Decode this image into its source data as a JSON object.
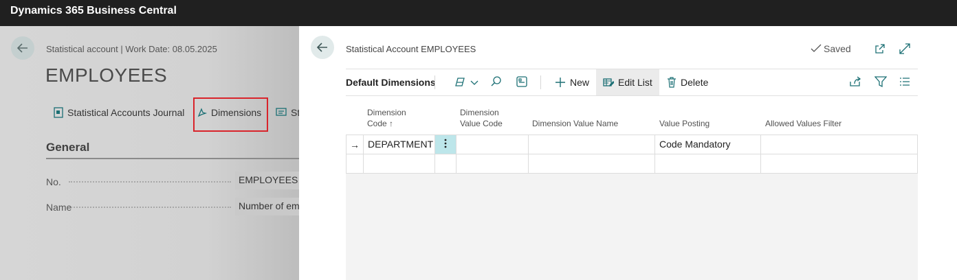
{
  "app": {
    "title": "Dynamics 365 Business Central"
  },
  "background_page": {
    "caption": "Statistical account | Work Date: 08.05.2025",
    "title": "EMPLOYEES",
    "actions": [
      {
        "label": "Statistical Accounts Journal",
        "icon": "journal-icon"
      },
      {
        "label": "Dimensions",
        "icon": "dimensions-icon"
      },
      {
        "label": "St",
        "icon": "statistics-icon"
      }
    ],
    "section_title": "General",
    "fields": [
      {
        "label": "No.",
        "value": "EMPLOYEES"
      },
      {
        "label": "Name",
        "value": "Number of em"
      }
    ]
  },
  "panel": {
    "caption": "Statistical Account EMPLOYEES",
    "saved_label": "Saved",
    "toolbar": {
      "title": "Default Dimensions",
      "new_label": "New",
      "edit_list_label": "Edit List",
      "delete_label": "Delete"
    },
    "grid": {
      "columns": [
        {
          "line1": "Dimension",
          "line2": "Code",
          "sort": "↑"
        },
        {
          "line1": "Dimension",
          "line2": "Value Code"
        },
        {
          "line1": "",
          "line2": "Dimension Value Name"
        },
        {
          "line1": "",
          "line2": "Value Posting"
        },
        {
          "line1": "",
          "line2": "Allowed Values Filter"
        }
      ],
      "rows": [
        {
          "marker": "→",
          "dimension_code": "DEPARTMENT",
          "dimension_value_code": "",
          "dimension_value_name": "",
          "value_posting": "Code Mandatory",
          "allowed_values_filter": ""
        },
        {
          "marker": "",
          "dimension_code": "",
          "dimension_value_code": "",
          "dimension_value_name": "",
          "value_posting": "",
          "allowed_values_filter": ""
        }
      ]
    }
  },
  "colors": {
    "topbar": "#202020",
    "highlight_box": "#d9232a",
    "accent": "#008489",
    "selected_cell": "#bde6ea"
  }
}
